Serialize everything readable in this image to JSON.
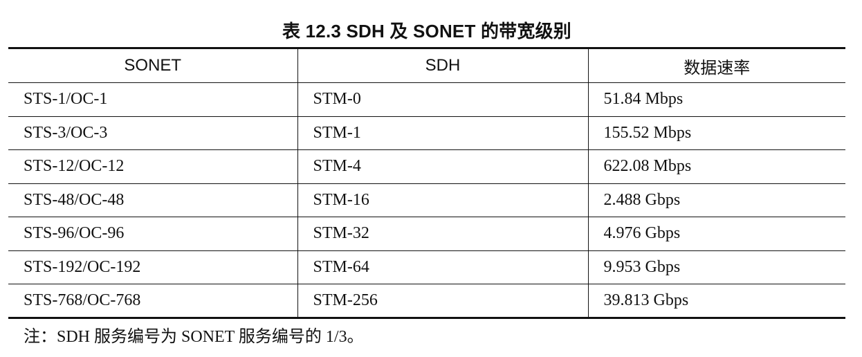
{
  "caption": "表 12.3    SDH 及 SONET 的带宽级别",
  "table": {
    "headers": [
      "SONET",
      "SDH",
      "数据速率"
    ],
    "rows": [
      [
        "STS-1/OC-1",
        "STM-0",
        "51.84 Mbps"
      ],
      [
        "STS-3/OC-3",
        "STM-1",
        "155.52 Mbps"
      ],
      [
        "STS-12/OC-12",
        "STM-4",
        "622.08 Mbps"
      ],
      [
        "STS-48/OC-48",
        "STM-16",
        "2.488 Gbps"
      ],
      [
        "STS-96/OC-96",
        "STM-32",
        "4.976 Gbps"
      ],
      [
        "STS-192/OC-192",
        "STM-64",
        "9.953 Gbps"
      ],
      [
        "STS-768/OC-768",
        "STM-256",
        "39.813 Gbps"
      ]
    ]
  },
  "note": "注：SDH 服务编号为 SONET 服务编号的 1/3。"
}
